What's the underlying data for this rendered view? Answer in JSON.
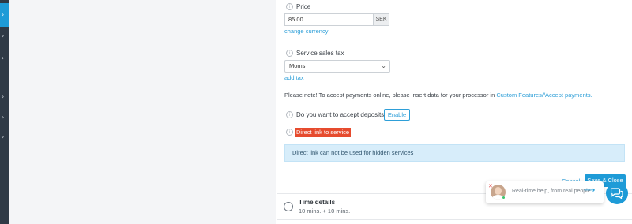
{
  "price": {
    "label": "Price",
    "value": "85.00",
    "currency": "SEK",
    "change_link": "change currency"
  },
  "tax": {
    "label": "Service sales tax",
    "selected": "Moms",
    "add_link": "add tax"
  },
  "payment_note": {
    "text": "Please note! To accept payments online, please insert data for your processor in",
    "link": "Custom Features//Accept payments."
  },
  "deposits": {
    "label": "Do you want to accept deposits?",
    "button": "Enable"
  },
  "direct_link": {
    "label": "Direct link to service",
    "alert": "Direct link can not be used for hidden services"
  },
  "actions": {
    "cancel": "Cancel",
    "save": "Save & Close"
  },
  "time_details": {
    "title": "Time details",
    "value": "10 mins. + 10 mins."
  },
  "chat": {
    "text": "Real-time help, from real people"
  },
  "colors": {
    "accent": "#1e9bd7",
    "danger": "#e64b2e",
    "alert_bg": "#d7edfa",
    "nav_bg": "#2f3a46"
  }
}
